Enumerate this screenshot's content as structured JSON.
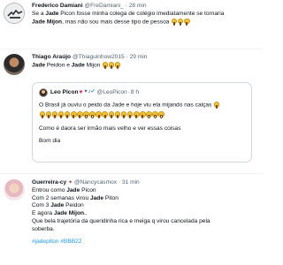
{
  "tweets": [
    {
      "name": "Frederico Damiani",
      "handle": "@FreDamiani_",
      "time": "28 min",
      "lines": [
        "Se a ",
        "Jade",
        " Picon fosse minha colega de colégio imediatamente se tornaria",
        "Jade Mijon",
        ", mas não sou mais desse tipo de pessoa"
      ]
    },
    {
      "name": "Thiago Araújo",
      "handle": "@Thiaguinhow2015",
      "time": "29 min",
      "line1a": "Jade",
      "line1b": " Peidon e ",
      "line1c": "Jade",
      "line1d": " Mijon"
    },
    {
      "quote_name": "Leo Picon",
      "quote_badges": "❤️ 🕶 🎵",
      "quote_handle": "@LeoPicon",
      "quote_time": "8 h",
      "quote_line1": "O Brasil já ouviu o peido da Jade e hoje viu ela mijando nas calças",
      "quote_line2": "Como é daora ser irmão mais velho e ver essas coisas",
      "quote_line3": "Bom dia"
    },
    {
      "name": "Guerreira-cy",
      "handle": "@Nancycasmox",
      "time": "31 min",
      "l1": "Entrou como ",
      "l1b": "Jade",
      "l1c": " Picon",
      "l2": "Com 2 semanas virou ",
      "l2b": "Jade",
      "l2c": " Piton",
      "l3": "Com 3 ",
      "l3b": "Jade",
      "l3c": " Peidon",
      "l4": "E agora ",
      "l4b": "Jade Mijon",
      "l4c": "..",
      "l5": "Que bela trajetória da queridinha rica e meiga q virou cancelada pela",
      "l6": "soberba.",
      "hashtags": "#jadepiton #BBB22"
    }
  ],
  "separator": "·"
}
